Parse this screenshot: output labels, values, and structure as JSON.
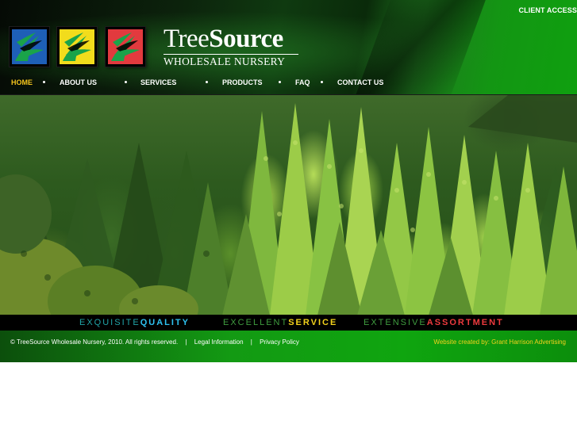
{
  "header": {
    "client_access": "CLIENT ACCESS",
    "brand_name_regular": "Tree",
    "brand_name_bold": "Source",
    "brand_subtitle": "WHOLESALE NURSERY",
    "logo_icons": [
      "leaf-tile-blue-icon",
      "leaf-tile-yellow-icon",
      "leaf-tile-red-icon"
    ]
  },
  "nav": {
    "items": [
      {
        "label": "HOME",
        "active": true
      },
      {
        "label": "ABOUT US",
        "active": false
      },
      {
        "label": "SERVICES",
        "active": false
      },
      {
        "label": "PRODUCTS",
        "active": false
      },
      {
        "label": "FAQ",
        "active": false
      },
      {
        "label": "CONTACT US",
        "active": false
      }
    ]
  },
  "slogan": {
    "items": [
      {
        "light": "EXQUISITE",
        "strong": "QUALITY",
        "light_color": "#21a5a8",
        "strong_color": "#2ec2f0"
      },
      {
        "light": "EXCELLENT",
        "strong": "SERVICE",
        "light_color": "#3f9c3f",
        "strong_color": "#f2d21c"
      },
      {
        "light": "EXTENSIVE",
        "strong": "ASSORTMENT",
        "light_color": "#3f9c3f",
        "strong_color": "#ee3a3e"
      }
    ]
  },
  "footer": {
    "copyright": "© TreeSource Wholesale Nursery, 2010. All rights reserved.",
    "separator": "|",
    "legal_link": "Legal Information",
    "privacy_link": "Privacy Policy",
    "credit": "Website created by: Grant Harrison Advertising"
  },
  "colors": {
    "nav_active": "#f4c51c",
    "footer_credit": "#f5d21e",
    "header_green": "#139613"
  }
}
